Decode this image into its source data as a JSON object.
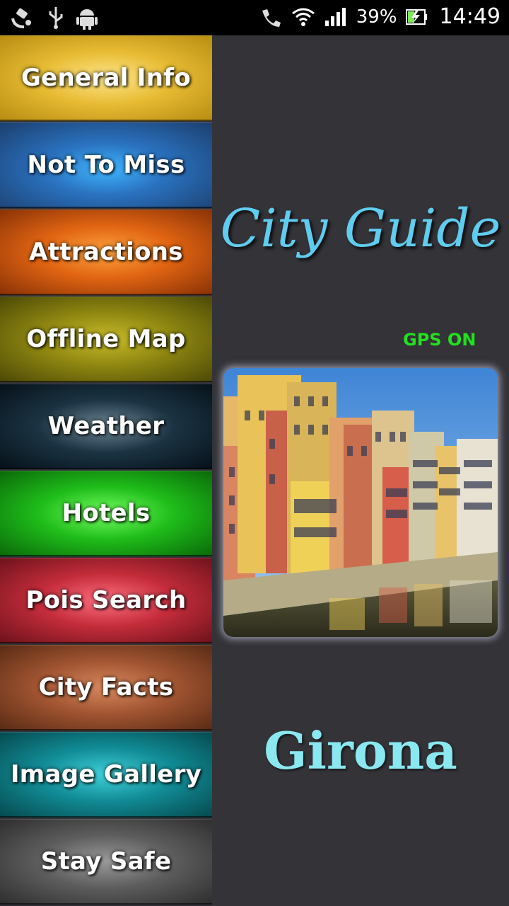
{
  "status_bar": {
    "battery_percent": "39%",
    "time": "14:49",
    "icons": [
      "satellite-icon",
      "usb-icon",
      "android-icon",
      "handset-icon",
      "wifi-icon",
      "signal-icon",
      "battery-icon"
    ]
  },
  "menu": {
    "items": [
      {
        "label": "General Info"
      },
      {
        "label": "Not To Miss"
      },
      {
        "label": "Attractions"
      },
      {
        "label": "Offline Map"
      },
      {
        "label": "Weather"
      },
      {
        "label": "Hotels"
      },
      {
        "label": "Pois Search"
      },
      {
        "label": "City Facts"
      },
      {
        "label": "Image Gallery"
      },
      {
        "label": "Stay Safe"
      }
    ]
  },
  "main": {
    "app_title": "City Guide",
    "gps_status": "GPS ON",
    "city_name": "Girona",
    "colors": {
      "title": "#5fcdf0",
      "gps": "#22e11d",
      "city_name": "#8ae8f0",
      "background": "#333338"
    }
  }
}
